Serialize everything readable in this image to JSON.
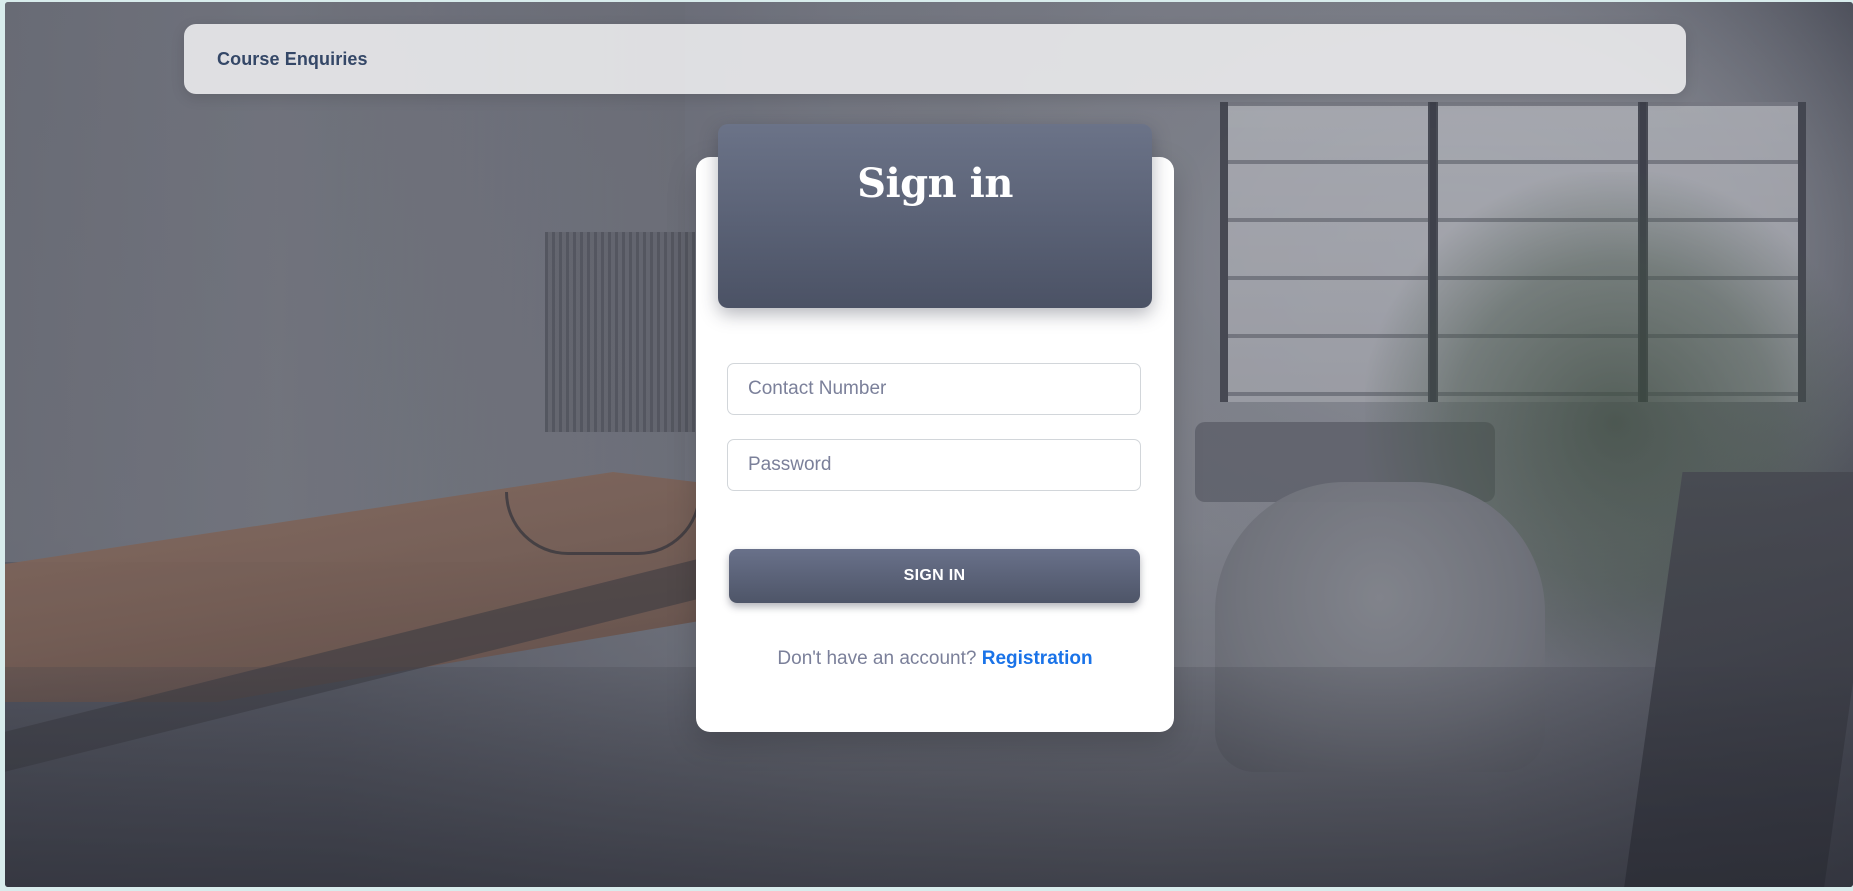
{
  "navbar": {
    "brand": "Course Enquiries"
  },
  "signin": {
    "title": "Sign in",
    "contact_placeholder": "Contact Number",
    "contact_value": "",
    "password_placeholder": "Password",
    "password_value": "",
    "submit_label": "SIGN IN",
    "no_account_text": "Don't have an account?",
    "register_link": "Registration"
  },
  "colors": {
    "header_gradient_top": "#6b7388",
    "header_gradient_bottom": "#4b5265",
    "brand_text": "#344767",
    "link": "#1a73e8",
    "muted_text": "#7b809a"
  }
}
